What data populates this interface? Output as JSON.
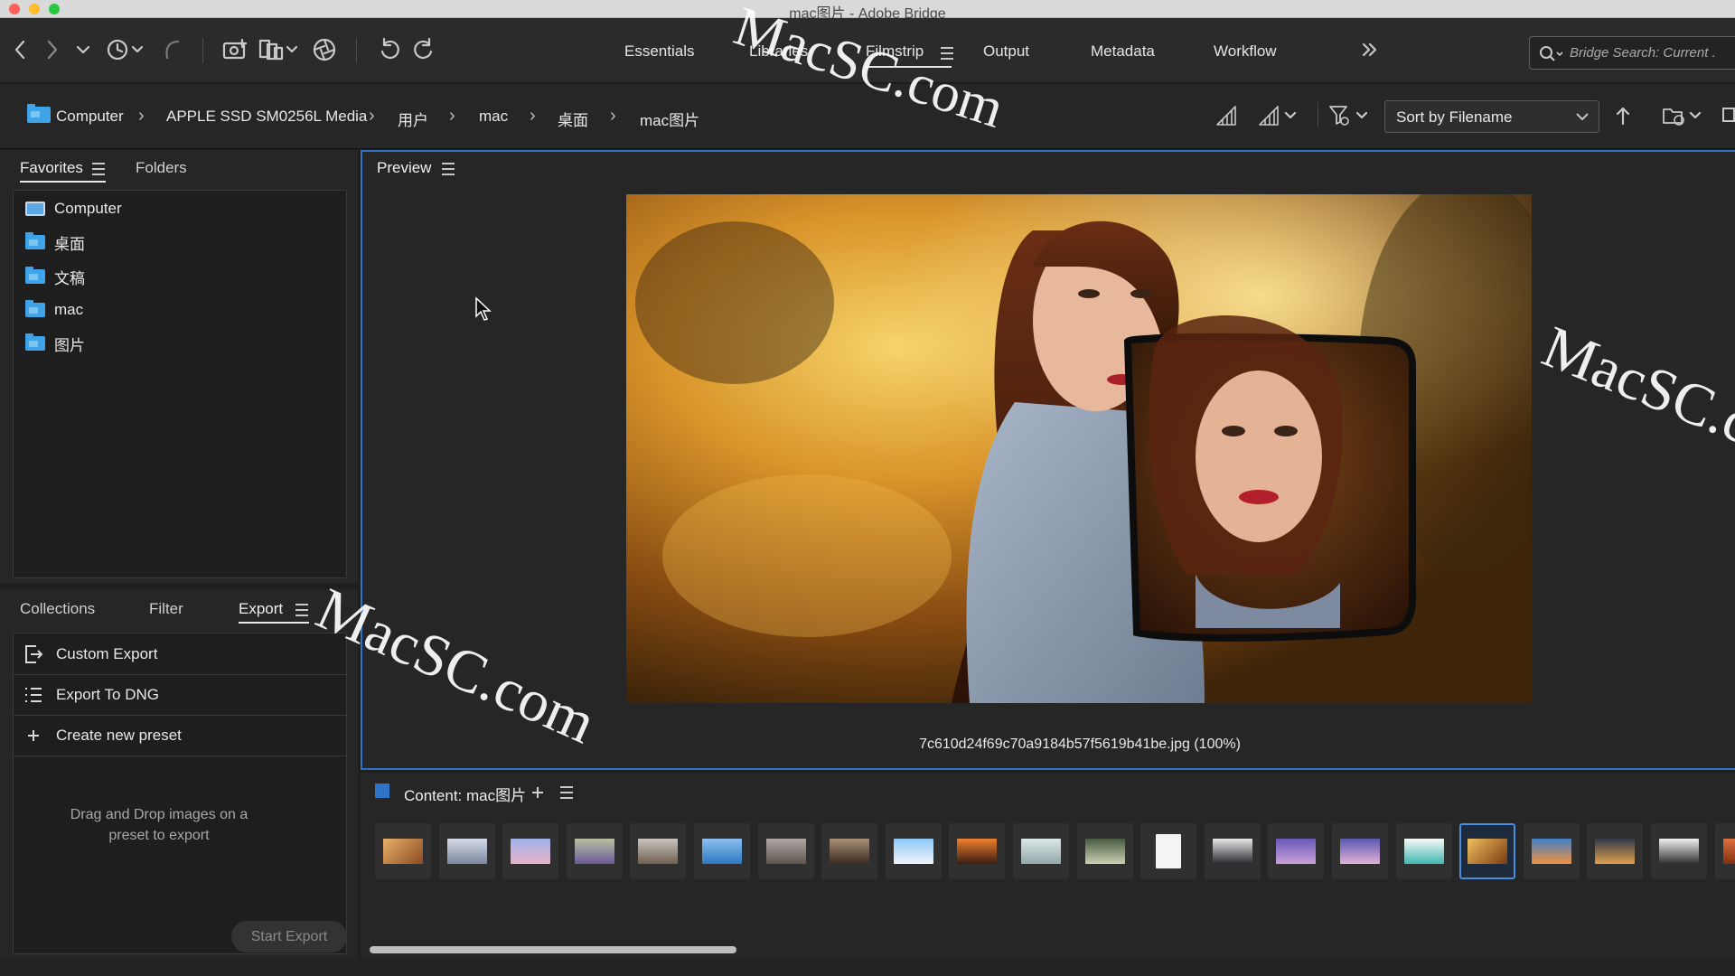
{
  "window": {
    "title": "mac图片 - Adobe Bridge"
  },
  "workspaces": [
    {
      "label": "Essentials"
    },
    {
      "label": "Libraries"
    },
    {
      "label": "Filmstrip"
    },
    {
      "label": "Output"
    },
    {
      "label": "Metadata"
    },
    {
      "label": "Workflow"
    }
  ],
  "active_workspace": "Filmstrip",
  "search": {
    "placeholder": "Bridge Search: Current ."
  },
  "breadcrumb": [
    "Computer",
    "APPLE SSD SM0256L Media",
    "用户",
    "mac",
    "桌面",
    "mac图片"
  ],
  "sort": {
    "label": "Sort by Filename"
  },
  "favorites_panel": {
    "tabs": [
      "Favorites",
      "Folders"
    ],
    "items": [
      "Computer",
      "桌面",
      "文稿",
      "mac",
      "图片"
    ]
  },
  "export_panel": {
    "tabs": [
      "Collections",
      "Filter",
      "Export"
    ],
    "presets": [
      "Custom Export",
      "Export To DNG",
      "Create new preset"
    ],
    "drop_hint_line1": "Drag and Drop images on a",
    "drop_hint_line2": "preset to export",
    "start_button": "Start Export"
  },
  "preview": {
    "tab": "Preview",
    "caption": "7c610d24f69c70a9184b57f5619b41be.jpg (100%)"
  },
  "content": {
    "title": "Content: mac图片"
  },
  "watermark": "MacSC.com",
  "colors": {
    "accent": "#2f73c6",
    "folder": "#3fa3e8",
    "selection": "#4a8ee0"
  }
}
